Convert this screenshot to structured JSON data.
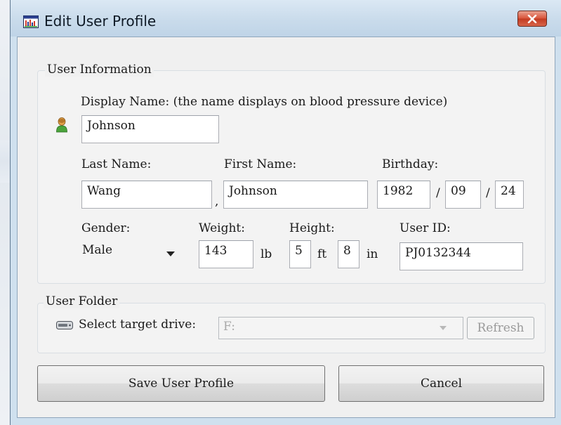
{
  "window": {
    "title": "Edit User Profile",
    "app_icon": "chart-app-icon",
    "close_icon": "close-x-icon"
  },
  "user_info": {
    "group_title": "User Information",
    "display_name_label": "Display Name: (the name displays on blood pressure device)",
    "display_name_value": "Johnson",
    "user_icon": "user-person-icon",
    "last_name_label": "Last Name:",
    "last_name_value": "Wang",
    "comma": ",",
    "first_name_label": "First Name:",
    "first_name_value": "Johnson",
    "birthday_label": "Birthday:",
    "birthday_year": "1982",
    "birthday_month": "09",
    "birthday_day": "24",
    "date_sep": "/",
    "gender_label": "Gender:",
    "gender_value": "Male",
    "weight_label": "Weight:",
    "weight_value": "143",
    "weight_unit": "lb",
    "height_label": "Height:",
    "height_ft_value": "5",
    "height_ft_unit": "ft",
    "height_in_value": "8",
    "height_in_unit": "in",
    "user_id_label": "User ID:",
    "user_id_value": "PJ0132344"
  },
  "user_folder": {
    "group_title": "User Folder",
    "drive_icon": "drive-icon",
    "select_drive_label": "Select target drive:",
    "drive_value": "F:",
    "refresh_label": "Refresh"
  },
  "actions": {
    "save_label": "Save User Profile",
    "cancel_label": "Cancel"
  }
}
